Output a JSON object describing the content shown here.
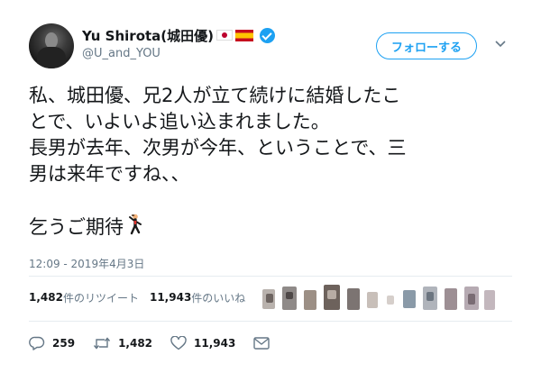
{
  "user": {
    "display_name": "Yu Shirota(城田優)",
    "handle": "@U_and_YOU",
    "flags": [
      "japan-flag",
      "spain-flag"
    ],
    "verified": true
  },
  "follow_button": {
    "label": "フォローする"
  },
  "tweet": {
    "lines": [
      "私、城田優、兄2人が立て続けに結婚したこ",
      "とで、いよいよ追い込まれました。",
      "長男が去年、次男が今年、ということで、三",
      "男は来年ですね、、"
    ],
    "closing": "乞うご期待",
    "closing_emoji": "man-dancing-emoji",
    "timestamp": "12:09 - 2019年4月3日"
  },
  "stats": {
    "retweets_count": "1,482",
    "retweets_label": "件のリツイート",
    "likes_count": "11,943",
    "likes_label": "件のいいね"
  },
  "actions": {
    "replies": "259",
    "retweets": "1,482",
    "likes": "11,943"
  },
  "colors": {
    "accent": "#1da1f2",
    "text": "#14171a",
    "muted": "#657786",
    "divider": "#e6ecf0"
  }
}
